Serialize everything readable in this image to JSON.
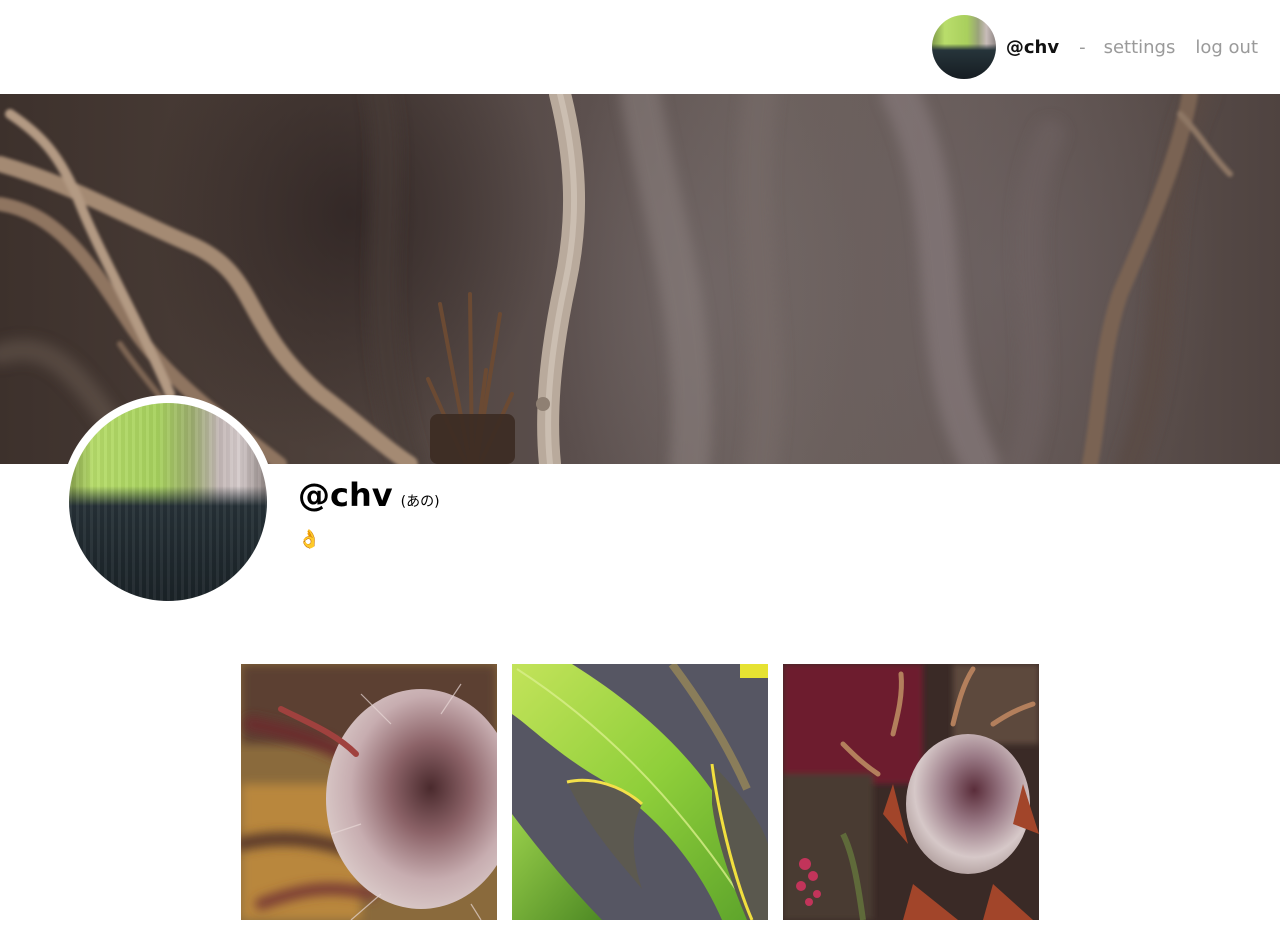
{
  "nav": {
    "handle": "@chv",
    "separator": "-",
    "settings_label": "settings",
    "logout_label": "log out"
  },
  "profile": {
    "handle": "@chv",
    "display_name": "(あの)",
    "bio": "👌"
  },
  "photos": [
    {
      "subject": "protea flower close-up"
    },
    {
      "subject": "green leaves with yellow edges"
    },
    {
      "subject": "protea bouquet"
    }
  ]
}
